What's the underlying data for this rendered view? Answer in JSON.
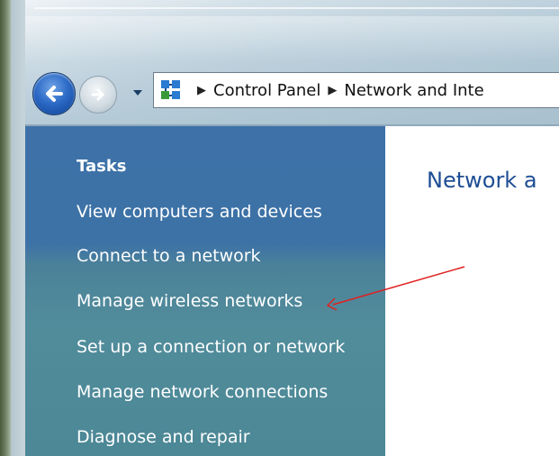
{
  "navigation": {
    "back_icon": "back-arrow-icon",
    "forward_icon": "forward-arrow-icon",
    "dropdown_icon": "chevron-down-icon"
  },
  "address_bar": {
    "icon": "control-panel-icon",
    "breadcrumbs": [
      "Control Panel",
      "Network and Inte"
    ]
  },
  "sidebar": {
    "title": "Tasks",
    "items": [
      {
        "label": "View computers and devices"
      },
      {
        "label": "Connect to a network"
      },
      {
        "label": "Manage wireless networks"
      },
      {
        "label": "Set up a connection or network"
      },
      {
        "label": "Manage network connections"
      },
      {
        "label": "Diagnose and repair"
      }
    ]
  },
  "main": {
    "heading": "Network a"
  },
  "annotation": {
    "type": "arrow",
    "color": "#e02020",
    "points_to": "Manage wireless networks"
  },
  "colors": {
    "task_pane_top": "#3d71a8",
    "task_pane_bottom": "#4c8896",
    "heading": "#1e4d94"
  }
}
